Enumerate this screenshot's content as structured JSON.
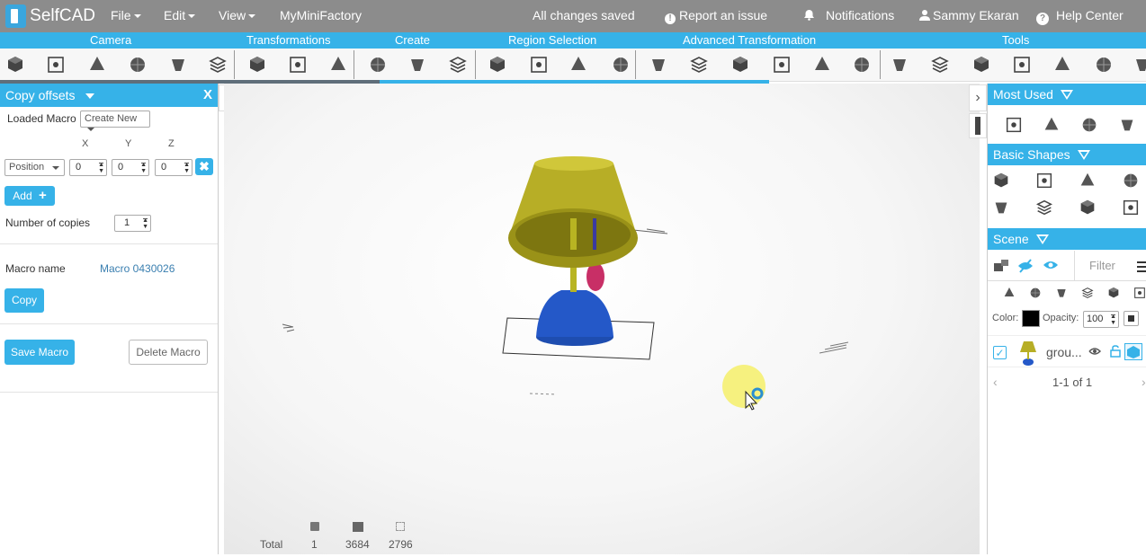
{
  "topbar": {
    "logo": "SelfCAD",
    "menus": [
      {
        "label": "File",
        "has_caret": true
      },
      {
        "label": "Edit",
        "has_caret": true
      },
      {
        "label": "View",
        "has_caret": true
      },
      {
        "label": "MyMiniFactory",
        "has_caret": false
      }
    ],
    "save_status": "All changes saved",
    "report_issue": "Report an issue",
    "notifications": "Notifications",
    "user": "Sammy Ekaran",
    "help": "Help Center"
  },
  "categories": [
    "Camera",
    "Transformations",
    "Create",
    "Region Selection",
    "Advanced Transformation",
    "Tools"
  ],
  "toolbar_icons": [
    "3d-view-icon",
    "zoom-icon",
    "pan-hand-icon",
    "rotate-view-icon",
    "camera-settings-icon",
    "fit-view-icon",
    "move-icon",
    "scale-icon",
    "rotate-icon",
    "extrude-icon",
    "taper-icon",
    "sculpt-icon",
    "select-box-icon",
    "select-face-icon",
    "select-wire-icon",
    "select-object-icon",
    "layers-icon",
    "grid-cube-icon",
    "cut-icon",
    "cone-icon",
    "twist-icon",
    "bend-icon",
    "wireframe-icon",
    "solid-cube-icon",
    "pattern-icon",
    "sphere-icon",
    "subdivide-icon",
    "hollow-icon",
    "more-tools-icon"
  ],
  "left_panel": {
    "title": "Copy offsets",
    "close": "X",
    "loaded_macro_label": "Loaded Macro",
    "loaded_macro_value": "Create New",
    "axes": [
      "X",
      "Y",
      "Z"
    ],
    "offset_type": "Position",
    "offsets": [
      "0",
      "0",
      "0"
    ],
    "add_label": "Add",
    "copies_label": "Number of copies",
    "copies_value": "1",
    "macro_name_label": "Macro name",
    "macro_name_value": "Macro 0430026",
    "copy_label": "Copy",
    "save_macro": "Save Macro",
    "delete_macro": "Delete Macro"
  },
  "viewport": {
    "stats_label": "Total",
    "stats": [
      "1",
      "3684",
      "2796"
    ]
  },
  "right_panel": {
    "most_used": "Most Used",
    "basic_shapes": "Basic Shapes",
    "scene": "Scene",
    "filter_placeholder": "Filter",
    "color_label": "Color:",
    "color_value": "#000000",
    "opacity_label": "Opacity:",
    "opacity_value": "100",
    "item_name": "grou...",
    "pagination": "1-1 of 1"
  },
  "colors": {
    "accent": "#36b2e8",
    "topbar": "#8c8c8c"
  }
}
